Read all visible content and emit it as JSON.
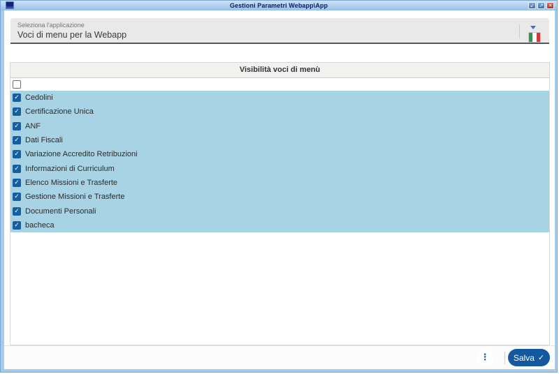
{
  "window": {
    "title": "Gestioni Parametri Webapp\\App",
    "controls": {
      "minimize_glyph": "↙",
      "maximize_glyph": "↗",
      "close_glyph": "✕"
    }
  },
  "form": {
    "app_select": {
      "label": "Seleziona l'applicazione",
      "value": "Voci di menu per la Webapp"
    },
    "language_flag": {
      "name": "italian-flag",
      "green": "#2E9A47",
      "white": "#FFFFFF",
      "red": "#CE3B3B"
    }
  },
  "table": {
    "header": "Visibilità voci di menù",
    "select_all_checked": false,
    "items": [
      {
        "label": "Cedolini",
        "checked": true
      },
      {
        "label": "Certificazione Unica",
        "checked": true
      },
      {
        "label": "ANF",
        "checked": true
      },
      {
        "label": "Dati Fiscali",
        "checked": true
      },
      {
        "label": "Variazione Accredito Retribuzioni",
        "checked": true
      },
      {
        "label": "Informazioni di Curriculum",
        "checked": true
      },
      {
        "label": "Elenco Missioni e Trasferte",
        "checked": true
      },
      {
        "label": "Gestione Missioni e Trasferte",
        "checked": true
      },
      {
        "label": "Documenti Personali",
        "checked": true
      },
      {
        "label": "bacheca",
        "checked": true
      }
    ]
  },
  "footer": {
    "more_glyph": "⋮",
    "save_label": "Salva",
    "save_check_glyph": "✓"
  },
  "colors": {
    "row_highlight": "#a8d3e4",
    "checkbox_blue": "#155fa0",
    "save_button_blue": "#14599f"
  }
}
